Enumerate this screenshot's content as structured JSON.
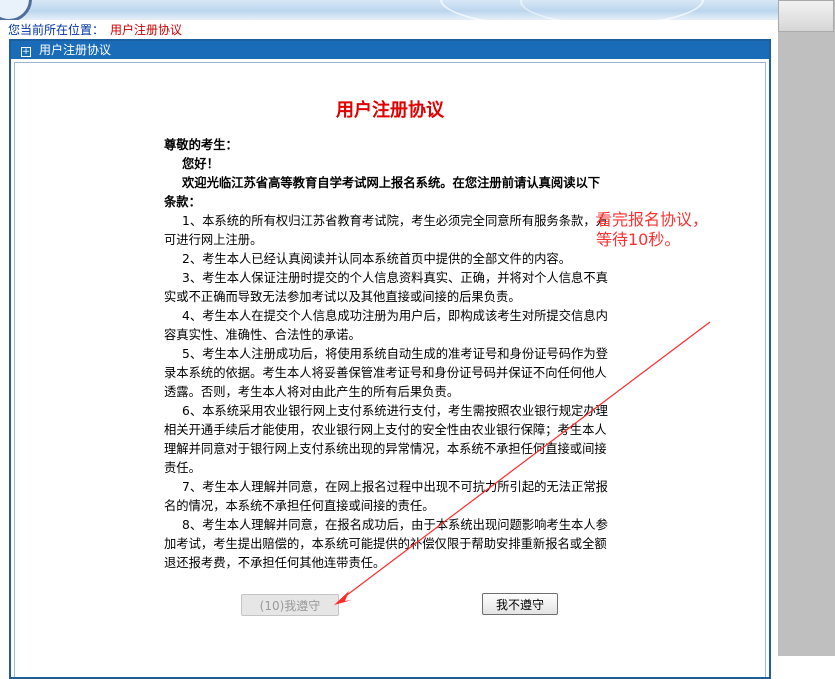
{
  "breadcrumb": {
    "prefix": "您当前所在位置：",
    "current": "用户注册协议"
  },
  "panel": {
    "header_title": "用户注册协议",
    "header_icon": "expand-icon"
  },
  "document": {
    "title": "用户注册协议",
    "salutation": "尊敬的考生：",
    "greeting": "您好！",
    "intro": "欢迎光临江苏省高等教育自学考试网上报名系统。在您注册前请认真阅读以下条款：",
    "clauses": [
      "1、本系统的所有权归江苏省教育考试院，考生必须完全同意所有服务条款，方可进行网上注册。",
      "2、考生本人已经认真阅读并认同本系统首页中提供的全部文件的内容。",
      "3、考生本人保证注册时提交的个人信息资料真实、正确，并将对个人信息不真实或不正确而导致无法参加考试以及其他直接或间接的后果负责。",
      "4、考生本人在提交个人信息成功注册为用户后，即构成该考生对所提交信息内容真实性、准确性、合法性的承诺。",
      "5、考生本人注册成功后，将使用系统自动生成的准考证号和身份证号码作为登录本系统的依据。考生本人将妥善保管准考证号和身份证号码并保证不向任何他人透露。否则，考生本人将对由此产生的所有后果负责。",
      "6、本系统采用农业银行网上支付系统进行支付，考生需按照农业银行规定办理相关开通手续后才能使用，农业银行网上支付的安全性由农业银行保障；考生本人理解并同意对于银行网上支付系统出现的异常情况，本系统不承担任何直接或间接责任。",
      "7、考生本人理解并同意，在网上报名过程中出现不可抗力所引起的无法正常报名的情况，本系统不承担任何直接或间接的责任。",
      "8、考生本人理解并同意，在报名成功后，由于本系统出现问题影响考生本人参加考试，考生提出赔偿的，本系统可能提供的补偿仅限于帮助安排重新报名或全额退还报考费，不承担任何其他连带责任。"
    ]
  },
  "buttons": {
    "agree_label": "(10)我遵守",
    "disagree_label": "我不遵守"
  },
  "annotation": {
    "line1": "看完报名协议，",
    "line2": "等待10秒。",
    "color": "#ff3030"
  },
  "colors": {
    "header_bg": "#1b6cb8",
    "title_red": "#e00000",
    "breadcrumb_blue": "#0033aa",
    "breadcrumb_red": "#cc0000"
  }
}
